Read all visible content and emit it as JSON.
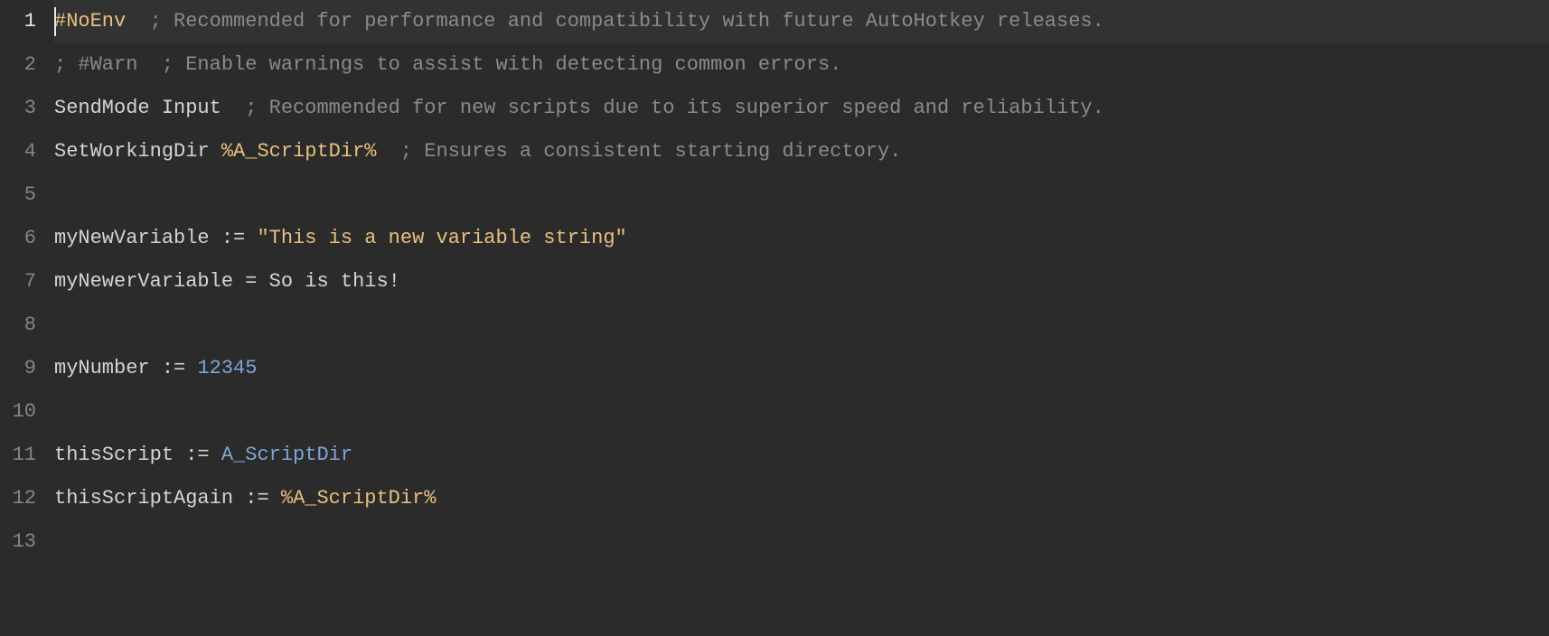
{
  "editor": {
    "active_line": 1,
    "lines": [
      {
        "num": 1,
        "tokens": [
          {
            "cls": "tok-directive",
            "text": "#NoEnv"
          },
          {
            "cls": "tok-plain",
            "text": "  "
          },
          {
            "cls": "tok-comment",
            "text": "; Recommended for performance and compatibility with future AutoHotkey releases."
          }
        ]
      },
      {
        "num": 2,
        "tokens": [
          {
            "cls": "tok-comment",
            "text": "; #Warn  ; Enable warnings to assist with detecting common errors."
          }
        ]
      },
      {
        "num": 3,
        "tokens": [
          {
            "cls": "tok-keyword",
            "text": "SendMode"
          },
          {
            "cls": "tok-plain",
            "text": " "
          },
          {
            "cls": "tok-keyword",
            "text": "Input"
          },
          {
            "cls": "tok-plain",
            "text": "  "
          },
          {
            "cls": "tok-comment",
            "text": "; Recommended for new scripts due to its superior speed and reliability."
          }
        ]
      },
      {
        "num": 4,
        "tokens": [
          {
            "cls": "tok-keyword",
            "text": "SetWorkingDir"
          },
          {
            "cls": "tok-plain",
            "text": " "
          },
          {
            "cls": "tok-percent",
            "text": "%"
          },
          {
            "cls": "tok-percvar",
            "text": "A_ScriptDir"
          },
          {
            "cls": "tok-percent",
            "text": "%"
          },
          {
            "cls": "tok-plain",
            "text": "  "
          },
          {
            "cls": "tok-comment",
            "text": "; Ensures a consistent starting directory."
          }
        ]
      },
      {
        "num": 5,
        "tokens": []
      },
      {
        "num": 6,
        "tokens": [
          {
            "cls": "tok-var",
            "text": "myNewVariable"
          },
          {
            "cls": "tok-plain",
            "text": " "
          },
          {
            "cls": "tok-op",
            "text": ":="
          },
          {
            "cls": "tok-plain",
            "text": " "
          },
          {
            "cls": "tok-string",
            "text": "\"This is a new variable string\""
          }
        ]
      },
      {
        "num": 7,
        "tokens": [
          {
            "cls": "tok-var",
            "text": "myNewerVariable"
          },
          {
            "cls": "tok-plain",
            "text": " "
          },
          {
            "cls": "tok-op",
            "text": "="
          },
          {
            "cls": "tok-plain",
            "text": " So is this!"
          }
        ]
      },
      {
        "num": 8,
        "tokens": []
      },
      {
        "num": 9,
        "tokens": [
          {
            "cls": "tok-var",
            "text": "myNumber"
          },
          {
            "cls": "tok-plain",
            "text": " "
          },
          {
            "cls": "tok-op",
            "text": ":="
          },
          {
            "cls": "tok-plain",
            "text": " "
          },
          {
            "cls": "tok-number",
            "text": "12345"
          }
        ]
      },
      {
        "num": 10,
        "tokens": []
      },
      {
        "num": 11,
        "tokens": [
          {
            "cls": "tok-var",
            "text": "thisScript"
          },
          {
            "cls": "tok-plain",
            "text": " "
          },
          {
            "cls": "tok-op",
            "text": ":="
          },
          {
            "cls": "tok-plain",
            "text": " "
          },
          {
            "cls": "tok-builtin",
            "text": "A_ScriptDir"
          }
        ]
      },
      {
        "num": 12,
        "tokens": [
          {
            "cls": "tok-var",
            "text": "thisScriptAgain"
          },
          {
            "cls": "tok-plain",
            "text": " "
          },
          {
            "cls": "tok-op",
            "text": ":="
          },
          {
            "cls": "tok-plain",
            "text": " "
          },
          {
            "cls": "tok-percent",
            "text": "%"
          },
          {
            "cls": "tok-percvar",
            "text": "A_ScriptDir"
          },
          {
            "cls": "tok-percent",
            "text": "%"
          }
        ]
      },
      {
        "num": 13,
        "tokens": []
      }
    ]
  }
}
